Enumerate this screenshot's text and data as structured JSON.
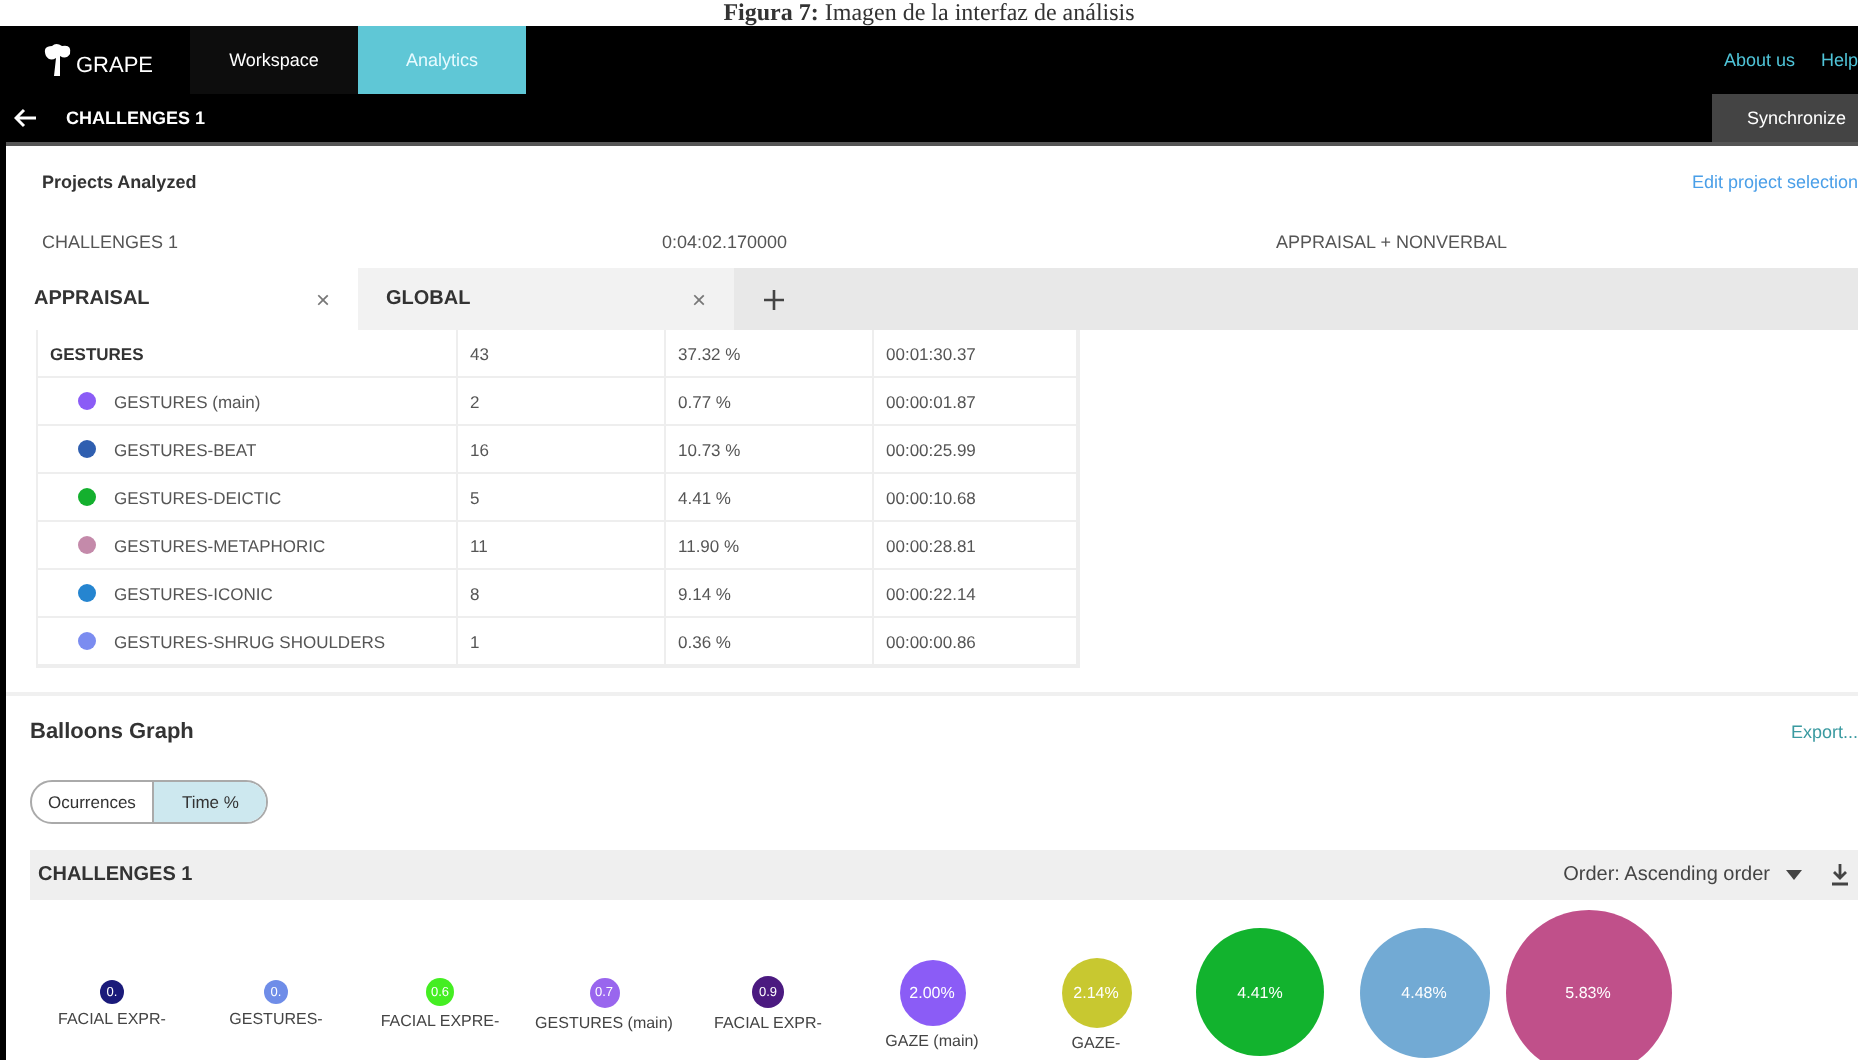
{
  "caption": "**Figura 7:** Imagen de la interfaz de análisis",
  "header": {
    "logo": "GRAPE",
    "tabs": [
      {
        "label": "Workspace",
        "selected": false
      },
      {
        "label": "Analytics",
        "selected": true
      }
    ],
    "links": [
      "About us",
      "Help"
    ],
    "title": "CHALLENGES 1",
    "action": "Synchronize"
  },
  "projects": {
    "heading": "Projects Analyzed",
    "edit_link": "Edit project selection",
    "rows": [
      {
        "name": "CHALLENGES 1",
        "duration": "0:04:02.170000",
        "schemes": "APPRAISAL + NONVERBAL"
      }
    ]
  },
  "analysis_tabs": [
    {
      "label": "APPRAISAL",
      "close": "×",
      "selected": true
    },
    {
      "label": "GLOBAL",
      "close": "×",
      "selected": false
    }
  ],
  "table": {
    "rows": [
      {
        "kind": "group",
        "name": "GESTURES",
        "count": "43",
        "percent": "37.32 %",
        "time": "00:01:30.37"
      },
      {
        "kind": "item",
        "name": "GESTURES (main)",
        "color": "#8b5cf6",
        "count": "2",
        "percent": "0.77 %",
        "time": "00:00:01.87"
      },
      {
        "kind": "item",
        "name": "GESTURES-BEAT",
        "color": "#2f5fb0",
        "count": "16",
        "percent": "10.73 %",
        "time": "00:00:25.99"
      },
      {
        "kind": "item",
        "name": "GESTURES-DEICTIC",
        "color": "#14b02e",
        "count": "5",
        "percent": "4.41 %",
        "time": "00:00:10.68"
      },
      {
        "kind": "item",
        "name": "GESTURES-METAPHORIC",
        "color": "#c48aaa",
        "count": "11",
        "percent": "11.90 %",
        "time": "00:00:28.81"
      },
      {
        "kind": "item",
        "name": "GESTURES-ICONIC",
        "color": "#2585d0",
        "count": "8",
        "percent": "9.14 %",
        "time": "00:00:22.14"
      },
      {
        "kind": "item",
        "name": "GESTURES-SHRUG SHOULDERS",
        "color": "#7b8cf0",
        "count": "1",
        "percent": "0.36 %",
        "time": "00:00:00.86"
      }
    ]
  },
  "balloons": {
    "title": "Balloons Graph",
    "export": "Export...",
    "toggle": [
      {
        "label": "Ocurrences",
        "selected": false
      },
      {
        "label": "Time %",
        "selected": true
      }
    ],
    "project": "CHALLENGES 1",
    "order": "Order: Ascending order",
    "items": [
      {
        "value": "0.",
        "label": "FACIAL EXPR-",
        "color": "#1a1a7a"
      },
      {
        "value": "0.",
        "label": "GESTURES-",
        "color": "#6f8de8"
      },
      {
        "value": "0.6",
        "label": "FACIAL EXPRE-",
        "color": "#44ee22"
      },
      {
        "value": "0.7",
        "label": "GESTURES (main)",
        "color": "#9966ee"
      },
      {
        "value": "0.9",
        "label": "FACIAL EXPR-",
        "color": "#4b1a80"
      },
      {
        "value": "2.00%",
        "label": "GAZE (main)",
        "color": "#8b5cf6"
      },
      {
        "value": "2.14%",
        "label": "GAZE-",
        "color": "#c8c830"
      },
      {
        "value": "4.41%",
        "color": "#12b32e"
      },
      {
        "value": "4.48%",
        "color": "#72aad4"
      },
      {
        "value": "5.83%",
        "color": "#c0508a"
      }
    ]
  }
}
